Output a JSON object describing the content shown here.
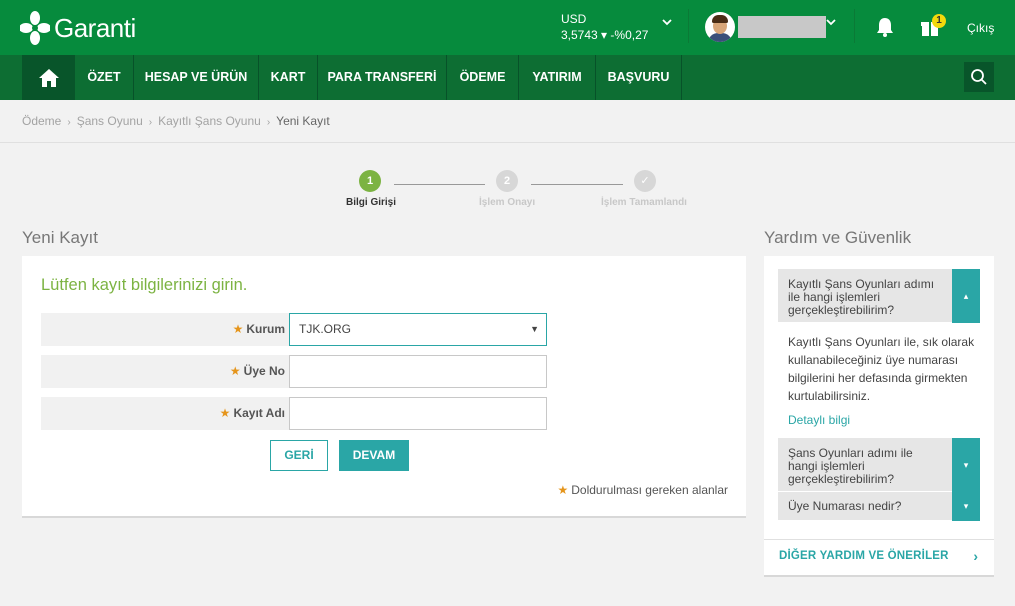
{
  "header": {
    "logo_text": "Garanti",
    "currency": {
      "code": "USD",
      "rate": "3,5743",
      "trend_icon": "▾",
      "change": "-%0,27"
    },
    "notification_count": "1",
    "logout_label": "Çıkış"
  },
  "nav": {
    "items": [
      "ÖZET",
      "HESAP VE ÜRÜN",
      "KART",
      "PARA TRANSFERİ",
      "ÖDEME",
      "YATIRIM",
      "BAŞVURU"
    ]
  },
  "breadcrumb": [
    "Ödeme",
    "Şans Oyunu",
    "Kayıtlı Şans Oyunu",
    "Yeni Kayıt"
  ],
  "stepper": {
    "steps": [
      {
        "number": "1",
        "label": "Bilgi Girişi"
      },
      {
        "number": "2",
        "label": "İşlem Onayı"
      },
      {
        "number": "✓",
        "label": "İşlem Tamamlandı"
      }
    ]
  },
  "form": {
    "section_title": "Yeni Kayıt",
    "heading": "Lütfen kayıt bilgilerinizi girin.",
    "fields": [
      {
        "label": "Kurum",
        "value": "TJK.ORG"
      },
      {
        "label": "Üye No",
        "value": ""
      },
      {
        "label": "Kayıt Adı",
        "value": ""
      }
    ],
    "back_label": "GERİ",
    "next_label": "DEVAM",
    "required_note": "Doldurulması gereken alanlar"
  },
  "help": {
    "section_title": "Yardım ve Güvenlik",
    "faqs": [
      {
        "question": "Kayıtlı Şans Oyunları adımı ile hangi işlemleri gerçekleştirebilirim?",
        "answer": "Kayıtlı Şans Oyunları ile, sık olarak kullanabileceğiniz üye numarası bilgilerini her defasında girmekten kurtulabilirsiniz.",
        "link": "Detaylı bilgi",
        "toggle": "▴"
      },
      {
        "question": "Şans Oyunları adımı ile hangi işlemleri gerçekleştirebilirim?",
        "toggle": "▾"
      },
      {
        "question": "Üye Numarası nedir?",
        "toggle": "▾"
      }
    ],
    "more_label": "DİĞER YARDIM VE ÖNERİLER"
  },
  "colors": {
    "brand_green": "#068b3d",
    "nav_green": "#0d6e33",
    "accent_teal": "#2aa6a6",
    "heading_green": "#7cb342",
    "required_star": "#e5951c"
  }
}
